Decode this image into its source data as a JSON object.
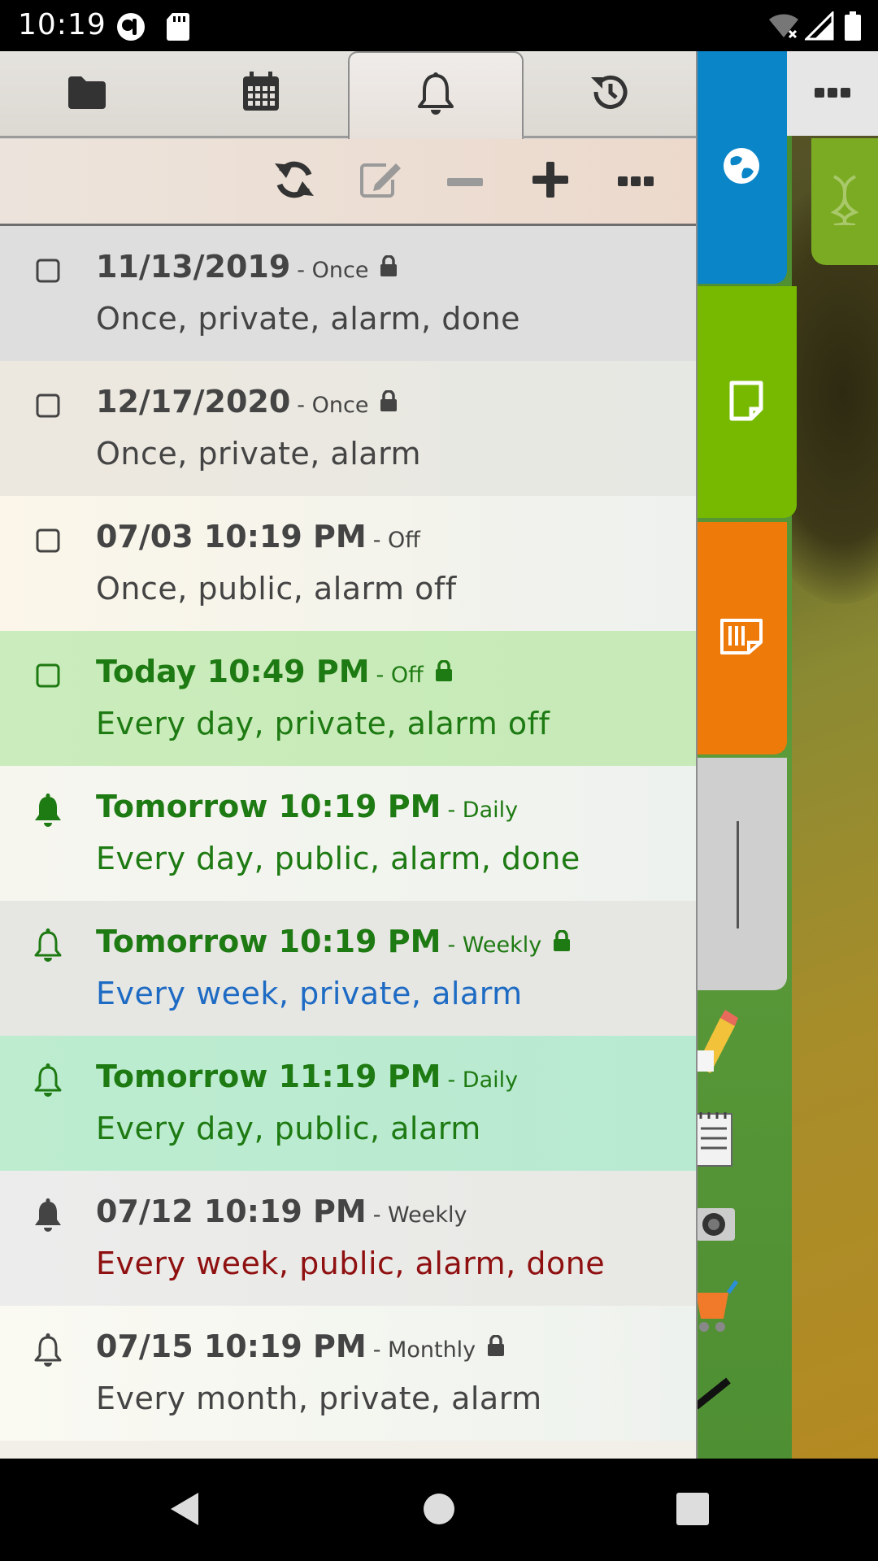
{
  "status_bar": {
    "time": "10:19"
  },
  "toolbar": {
    "refresh": "refresh-icon",
    "edit": "edit-icon",
    "remove": "minus-icon",
    "add": "plus-icon",
    "more": "more-icon"
  },
  "tabs": [
    {
      "name": "folder",
      "icon": "folder-icon"
    },
    {
      "name": "calendar",
      "icon": "calendar-icon"
    },
    {
      "name": "alarms",
      "icon": "bell-icon",
      "active": true
    },
    {
      "name": "history",
      "icon": "history-icon"
    }
  ],
  "colors": {
    "green_text": "#1e7a12",
    "blue_text": "#1e6bc4",
    "red_text": "#8f1010",
    "gray_text": "#444444"
  },
  "items": [
    {
      "title": "11/13/2019",
      "freq": "- Once",
      "locked": true,
      "desc": "Once, private, alarm, done",
      "icon": "checkbox-icon",
      "color": "gray"
    },
    {
      "title": "12/17/2020",
      "freq": "- Once",
      "locked": true,
      "desc": "Once, private, alarm",
      "icon": "checkbox-icon",
      "color": "gray"
    },
    {
      "title": "07/03 10:19 PM",
      "freq": "- Off",
      "locked": false,
      "desc": "Once, public, alarm off",
      "icon": "checkbox-icon",
      "color": "gray"
    },
    {
      "title": "Today 10:49 PM",
      "freq": "- Off",
      "locked": true,
      "desc": "Every day, private, alarm off",
      "icon": "checkbox-icon",
      "color": "green"
    },
    {
      "title": "Tomorrow 10:19 PM",
      "freq": "- Daily",
      "locked": false,
      "desc": "Every day, public, alarm, done",
      "icon": "bell-filled-icon",
      "color": "green"
    },
    {
      "title": "Tomorrow 10:19 PM",
      "freq": "- Weekly",
      "locked": true,
      "desc": "Every week, private, alarm",
      "icon": "bell-outline-icon",
      "color": "green",
      "desc_color": "blue"
    },
    {
      "title": "Tomorrow 11:19 PM",
      "freq": "- Daily",
      "locked": false,
      "desc": "Every day, public, alarm",
      "icon": "bell-outline-icon",
      "color": "green"
    },
    {
      "title": "07/12 10:19 PM",
      "freq": "- Weekly",
      "locked": false,
      "desc": "Every week, public, alarm, done",
      "icon": "bell-filled-icon",
      "color": "gray",
      "desc_color": "red"
    },
    {
      "title": "07/15 10:19 PM",
      "freq": "- Monthly",
      "locked": true,
      "desc": "Every month, private, alarm",
      "icon": "bell-outline-icon",
      "color": "gray"
    }
  ],
  "side_tabs": [
    {
      "name": "world",
      "icon": "globe-icon"
    },
    {
      "name": "notes",
      "icon": "note-icon"
    },
    {
      "name": "sticky",
      "icon": "sticky-note-icon"
    },
    {
      "name": "dna",
      "icon": "dna-icon"
    }
  ]
}
